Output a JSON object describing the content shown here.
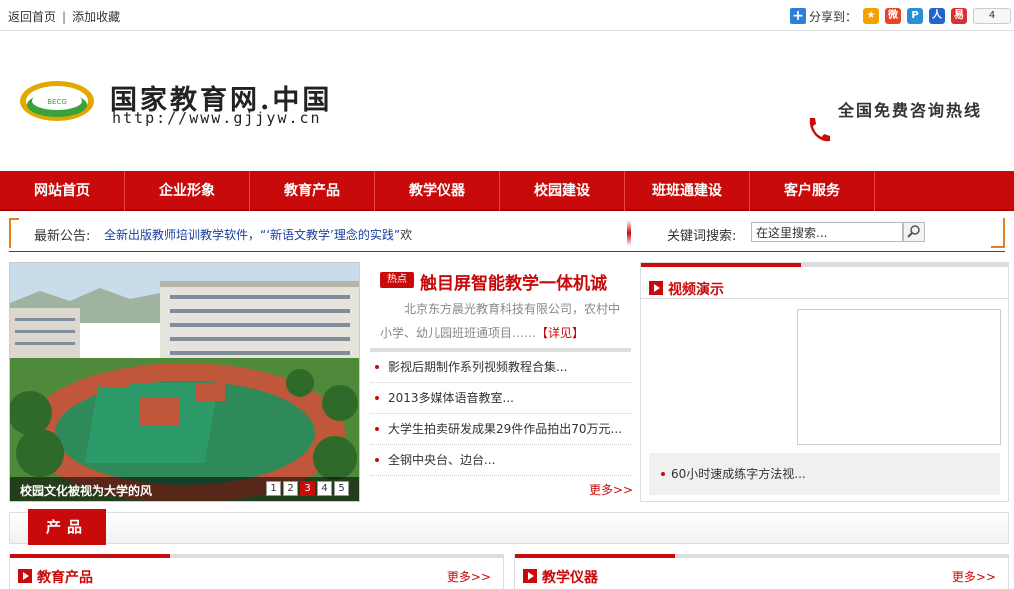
{
  "topbar": {
    "home": "返回首页",
    "favorite": "添加收藏",
    "share_label": "分享到：",
    "share_count": "4"
  },
  "header": {
    "site_title": "国家教育网.中国",
    "site_url": "http://www.gjjyw.cn",
    "hotline": "全国免费咨询热线"
  },
  "nav": {
    "items": [
      "网站首页",
      "企业形象",
      "教育产品",
      "教学仪器",
      "校园建设",
      "班班通建设",
      "客户服务"
    ]
  },
  "notice": {
    "label": "最新公告:",
    "text": "全新出版教师培训教学软件，“‘新语文教学’理念的实践”",
    "tail": "欢",
    "search_label": "关键词搜索:",
    "search_value": "在这里搜索..."
  },
  "slide": {
    "caption": "校园文化被视为大学的风",
    "pages": [
      "1",
      "2",
      "3",
      "4",
      "5"
    ]
  },
  "headline": {
    "badge": "热点",
    "title": "触目屏智能教学一体机诚",
    "desc": "北京东方晨光教育科技有限公司，农村中小学、幼儿园班班通项目……",
    "more": "【详见】"
  },
  "news": {
    "items": [
      "影视后期制作系列视频教程合集...",
      "2013多媒体语音教室...",
      "大学生拍卖研发成果29件作品拍出70万元...",
      "全钢中央台、边台..."
    ],
    "more": "更多>>"
  },
  "video": {
    "title": "视频演示",
    "item": "60小时速成练字方法视..."
  },
  "products": {
    "tab": "产品",
    "sections": [
      {
        "title": "教育产品",
        "more": "更多>>"
      },
      {
        "title": "教学仪器",
        "more": "更多>>"
      }
    ]
  }
}
